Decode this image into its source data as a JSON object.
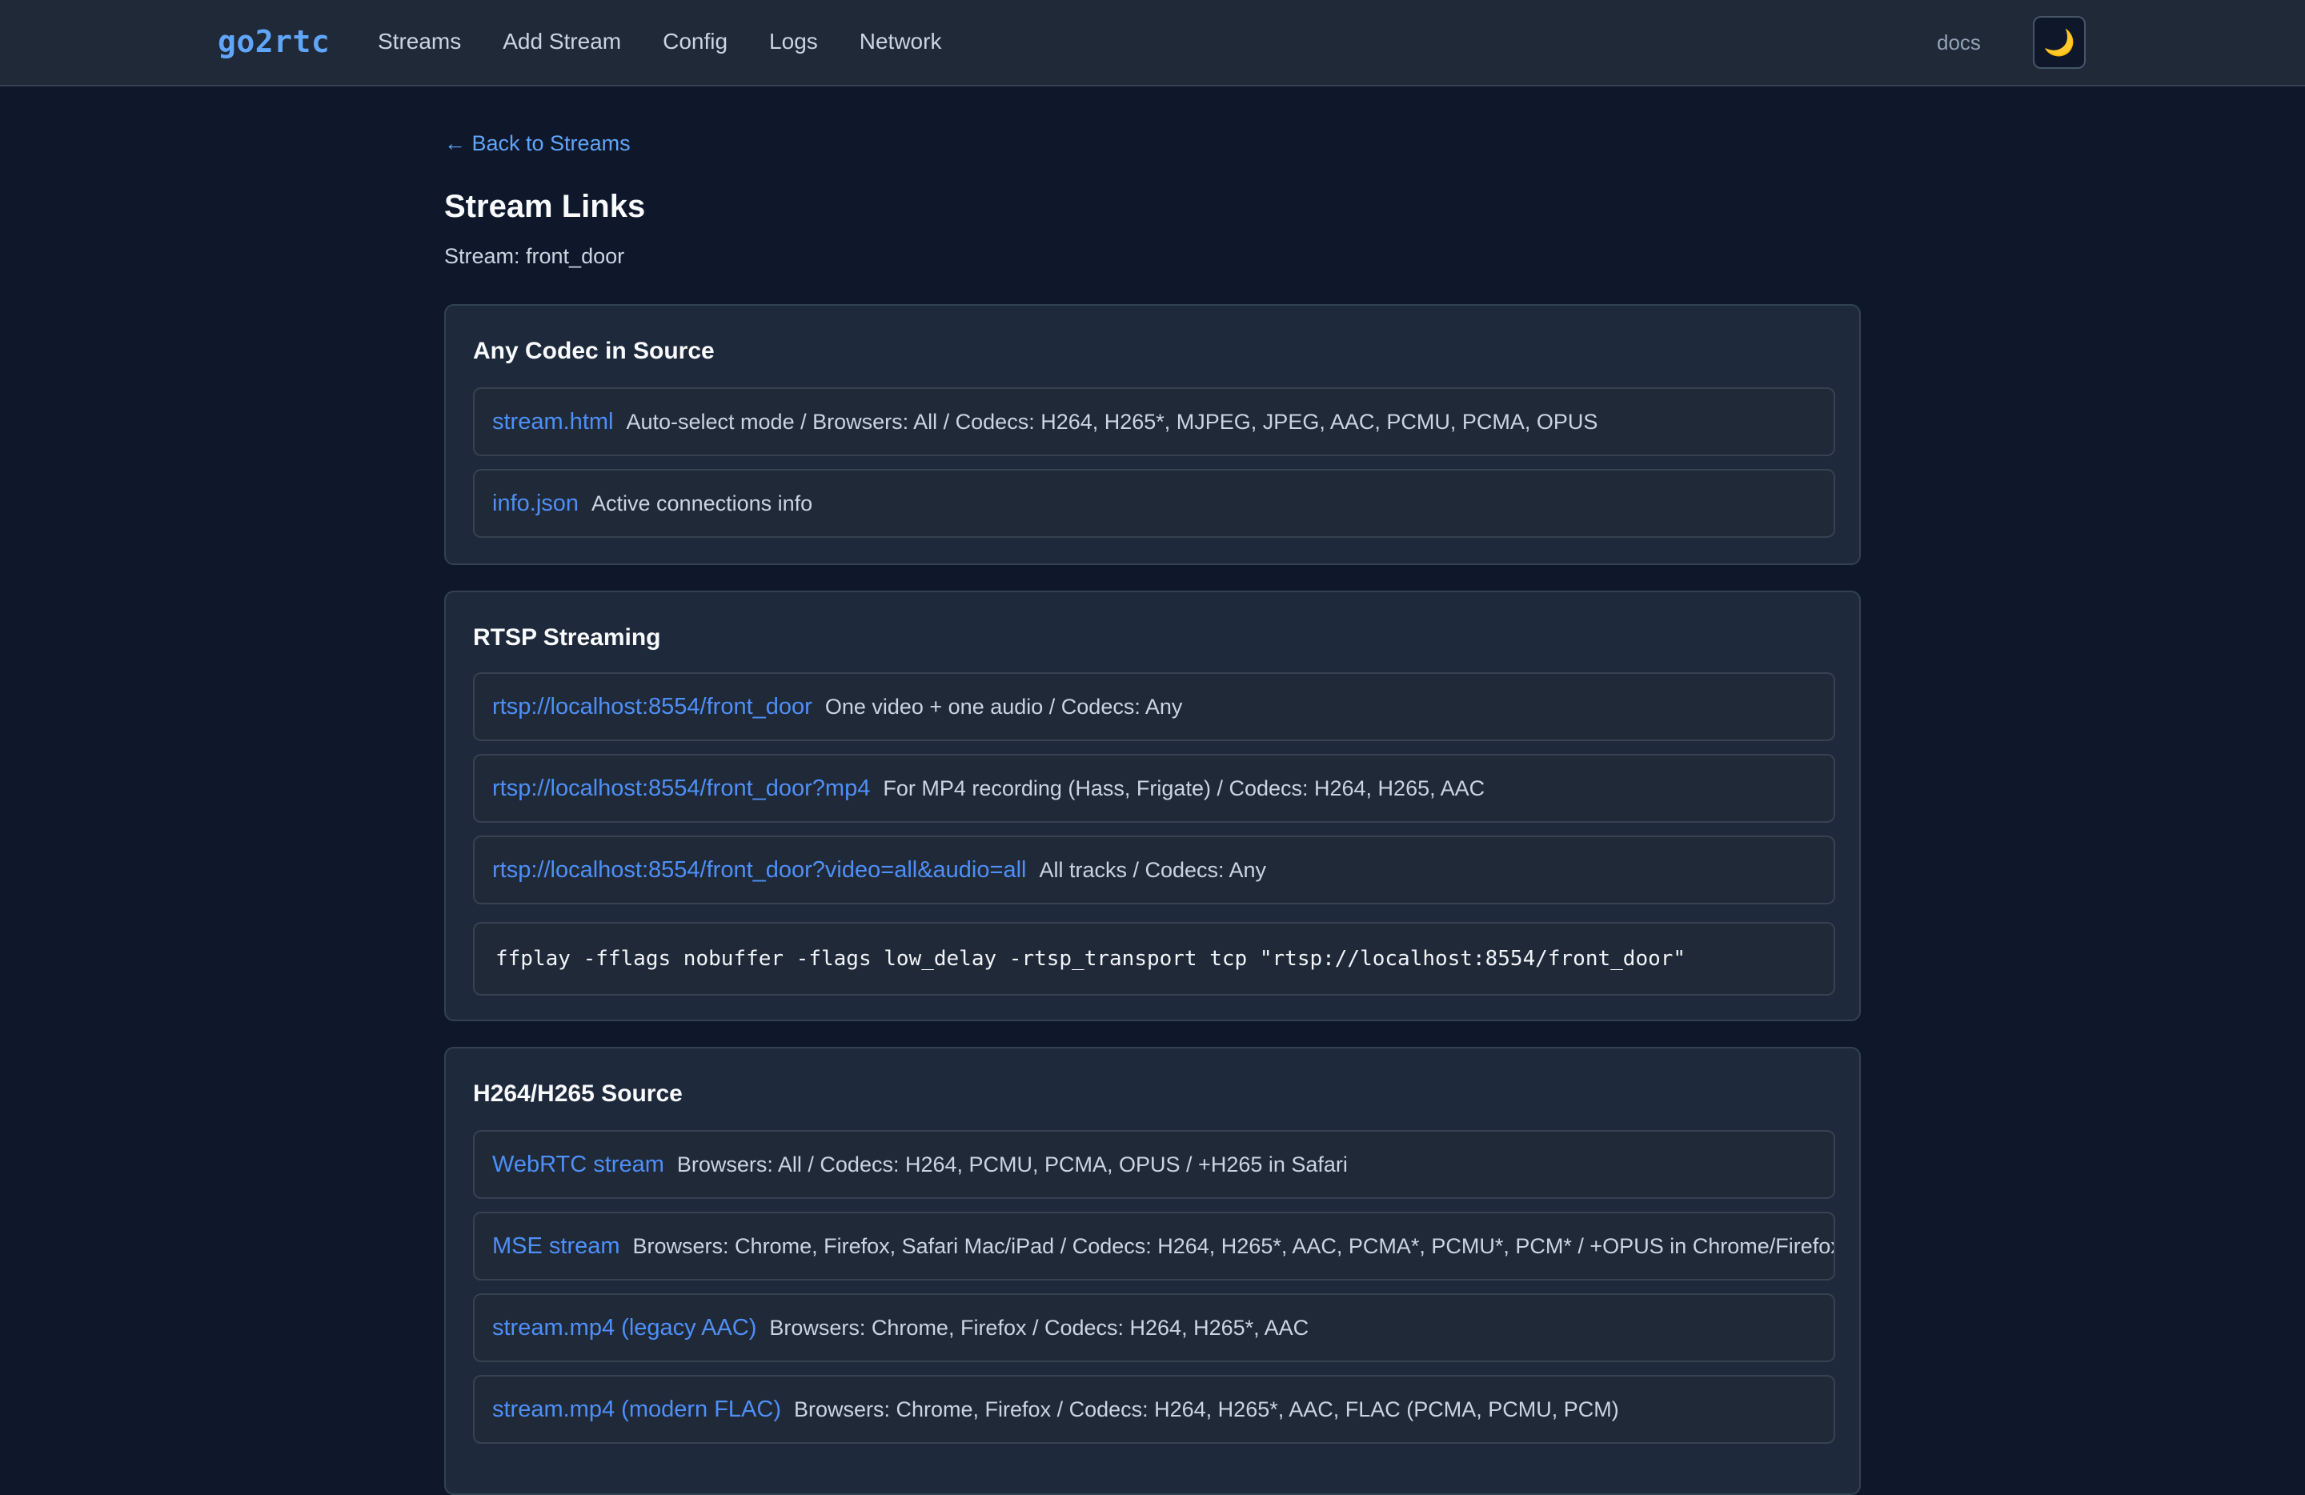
{
  "header": {
    "brand": "go2rtc",
    "nav": [
      "Streams",
      "Add Stream",
      "Config",
      "Logs",
      "Network"
    ],
    "docs": "docs",
    "theme_icon": "moon-icon",
    "theme_glyph": "🌙"
  },
  "page": {
    "back": "← Back to Streams",
    "title": "Stream Links",
    "subtitle": "Stream: front_door"
  },
  "sections": [
    {
      "title": "Any Codec in Source",
      "rows": [
        {
          "link": "stream.html",
          "desc": "Auto-select mode / Browsers: All / Codecs: H264, H265*, MJPEG, JPEG, AAC, PCMU, PCMA, OPUS"
        },
        {
          "link": "info.json",
          "desc": "Active connections info"
        }
      ]
    },
    {
      "title": "RTSP Streaming",
      "rows": [
        {
          "link": "rtsp://localhost:8554/front_door",
          "desc": "One video + one audio / Codecs: Any"
        },
        {
          "link": "rtsp://localhost:8554/front_door?mp4",
          "desc": "For MP4 recording (Hass, Frigate) / Codecs: H264, H265, AAC"
        },
        {
          "link": "rtsp://localhost:8554/front_door?video=all&audio=all",
          "desc": "All tracks / Codecs: Any"
        }
      ],
      "code": "ffplay -fflags nobuffer -flags low_delay -rtsp_transport tcp \"rtsp://localhost:8554/front_door\""
    },
    {
      "title": "H264/H265 Source",
      "rows": [
        {
          "link": "WebRTC stream",
          "desc": "Browsers: All / Codecs: H264, PCMU, PCMA, OPUS / +H265 in Safari"
        },
        {
          "link": "MSE stream",
          "desc": "Browsers: Chrome, Firefox, Safari Mac/iPad / Codecs: H264, H265*, AAC, PCMA*, PCMU*, PCM* / +OPUS in Chrome/Firefox"
        },
        {
          "link": "stream.mp4 (legacy AAC)",
          "desc": "Browsers: Chrome, Firefox / Codecs: H264, H265*, AAC"
        },
        {
          "link": "stream.mp4 (modern FLAC)",
          "desc": "Browsers: Chrome, Firefox / Codecs: H264, H265*, AAC, FLAC (PCMA, PCMU, PCM)"
        }
      ]
    }
  ]
}
